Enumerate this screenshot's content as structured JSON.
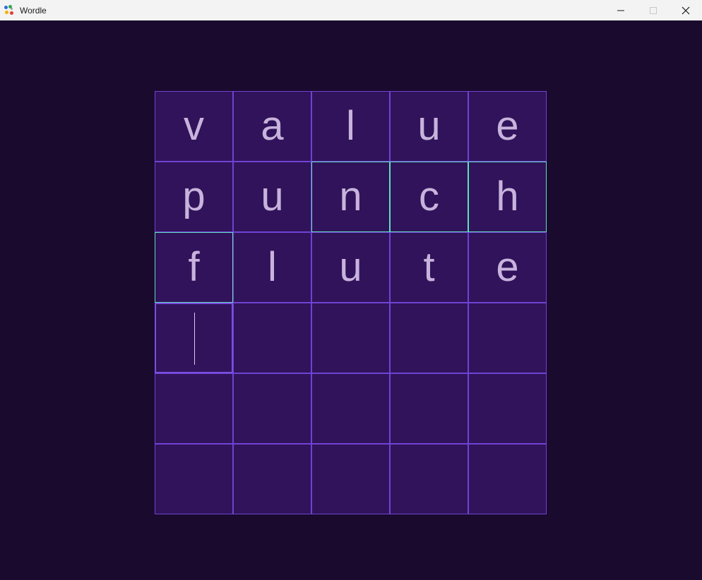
{
  "window": {
    "title": "Wordle",
    "controls": [
      "minimize",
      "maximize",
      "close"
    ]
  },
  "colors": {
    "background": "#1a0a2e",
    "tile_fill": "#30135a",
    "tile_border": "#7042d4",
    "present_border": "#5fdfbd",
    "letter": "#c7b3dc"
  },
  "board": {
    "rows": [
      [
        {
          "letter": "v",
          "state": "default"
        },
        {
          "letter": "a",
          "state": "default"
        },
        {
          "letter": "l",
          "state": "default"
        },
        {
          "letter": "u",
          "state": "default"
        },
        {
          "letter": "e",
          "state": "default"
        }
      ],
      [
        {
          "letter": "p",
          "state": "default"
        },
        {
          "letter": "u",
          "state": "default"
        },
        {
          "letter": "n",
          "state": "present"
        },
        {
          "letter": "c",
          "state": "present"
        },
        {
          "letter": "h",
          "state": "present"
        }
      ],
      [
        {
          "letter": "f",
          "state": "present"
        },
        {
          "letter": "l",
          "state": "default"
        },
        {
          "letter": "u",
          "state": "default"
        },
        {
          "letter": "t",
          "state": "default"
        },
        {
          "letter": "e",
          "state": "default"
        }
      ],
      [
        {
          "letter": "",
          "state": "active"
        },
        {
          "letter": "",
          "state": "empty"
        },
        {
          "letter": "",
          "state": "empty"
        },
        {
          "letter": "",
          "state": "empty"
        },
        {
          "letter": "",
          "state": "empty"
        }
      ],
      [
        {
          "letter": "",
          "state": "empty"
        },
        {
          "letter": "",
          "state": "empty"
        },
        {
          "letter": "",
          "state": "empty"
        },
        {
          "letter": "",
          "state": "empty"
        },
        {
          "letter": "",
          "state": "empty"
        }
      ],
      [
        {
          "letter": "",
          "state": "empty"
        },
        {
          "letter": "",
          "state": "empty"
        },
        {
          "letter": "",
          "state": "empty"
        },
        {
          "letter": "",
          "state": "empty"
        },
        {
          "letter": "",
          "state": "empty"
        }
      ]
    ]
  }
}
